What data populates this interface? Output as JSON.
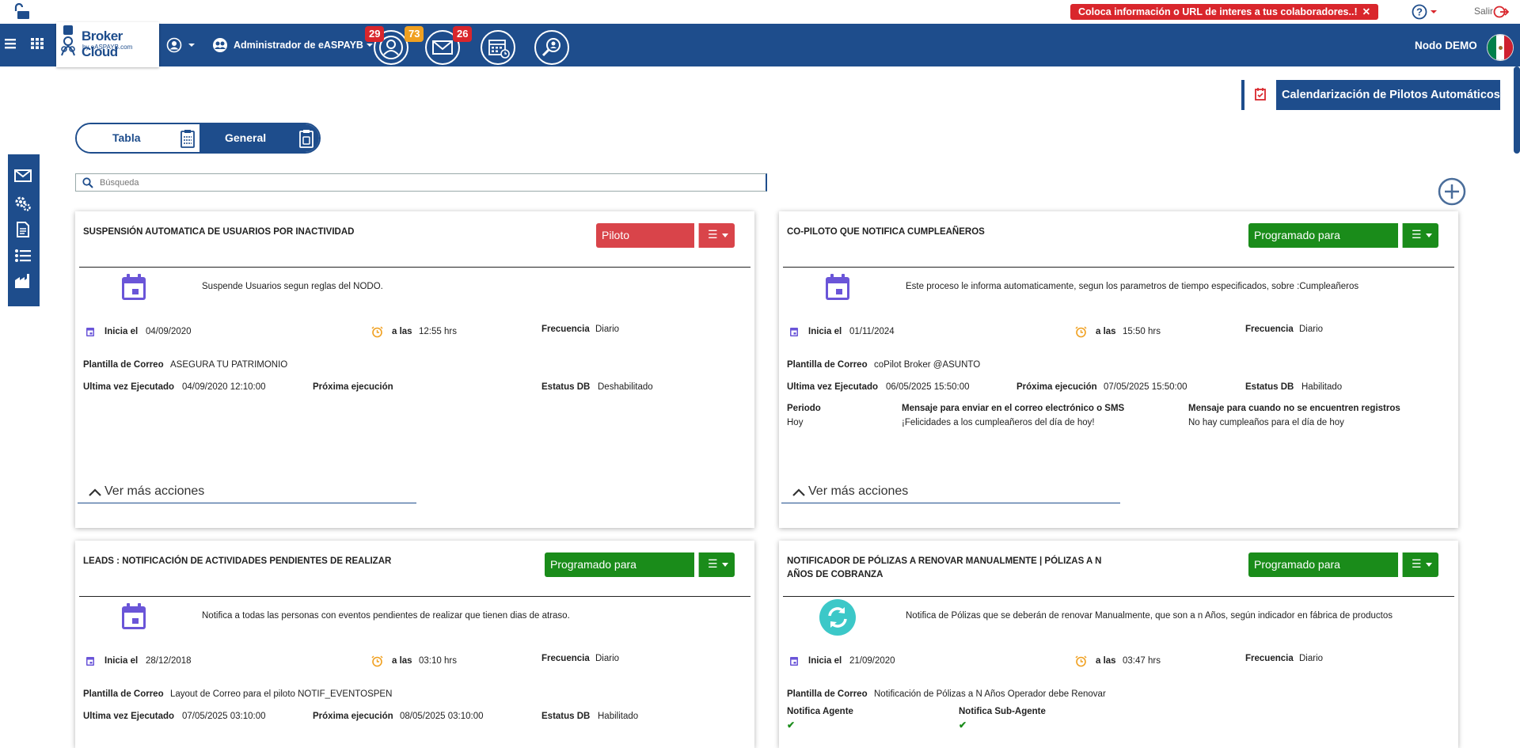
{
  "topbar": {
    "promo_text": "Coloca información o URL de interes a tus colaboradores..!",
    "promo_close": "✕",
    "logout_label": "Salir"
  },
  "nav": {
    "logo_title": "Broker Cloud",
    "logo_subtitle": "by eASPAYB.com",
    "admin_label": "Administrador de eASPAYB",
    "badge_users": "29",
    "badge_tasks": "73",
    "badge_mail": "26",
    "node_label": "Nodo DEMO"
  },
  "toolbar": {
    "calendar_button": "Calendarización de Pilotos Automáticos",
    "tab_table": "Tabla",
    "tab_general": "General",
    "search_placeholder": "Búsqueda"
  },
  "labels": {
    "inicia": "Inicia el",
    "a_las": "a las",
    "frecuencia": "Frecuencia",
    "plantilla": "Plantilla de Correo",
    "ultima": "Ultima vez Ejecutado",
    "proxima": "Próxima ejecución",
    "estatus": "Estatus DB",
    "periodo": "Periodo",
    "mensaje": "Mensaje para enviar en el correo electrónico o SMS",
    "mensaje_sin": "Mensaje para cuando no se encuentren registros",
    "notifica_agente": "Notifica Agente",
    "notifica_sub": "Notifica Sub-Agente",
    "ver_mas": "Ver más acciones",
    "menu_icon": "☰"
  },
  "cards": [
    {
      "title": "SUSPENSIÓN AUTOMATICA DE USUARIOS POR INACTIVIDAD",
      "status": "Piloto Suspendido",
      "status_color": "#d9444a",
      "icon": "calendar-icon",
      "description": "Suspende Usuarios segun reglas del NODO.",
      "inicia": "04/09/2020",
      "hora": "12:55 hrs",
      "frecuencia": "Diario",
      "plantilla": "ASEGURA TU PATRIMONIO",
      "ultima": "04/09/2020 12:10:00",
      "proxima": "",
      "estatus": "Deshabilitado"
    },
    {
      "title": "CO-PILOTO QUE NOTIFICA CUMPLEAÑEROS",
      "status": "Programado para Ejecutarse",
      "status_color": "#1a8c1a",
      "icon": "calendar-icon",
      "description": "Este proceso le informa automaticamente, segun los parametros de tiempo especificados, sobre :Cumpleañeros",
      "inicia": "01/11/2024",
      "hora": "15:50 hrs",
      "frecuencia": "Diario",
      "plantilla": "coPilot Broker @ASUNTO",
      "ultima": "06/05/2025 15:50:00",
      "proxima": "07/05/2025 15:50:00",
      "estatus": "Habilitado",
      "periodo": "Hoy",
      "mensaje": "¡Felicidades a los cumpleañeros del día de hoy!",
      "mensaje_sin": "No hay cumpleaños para el día de hoy"
    },
    {
      "title": "LEADS : NOTIFICACIÓN DE ACTIVIDADES PENDIENTES DE REALIZAR",
      "status": "Programado para Ejecutarse",
      "status_color": "#1a8c1a",
      "icon": "calendar-icon",
      "description": "Notifica a todas las personas con eventos pendientes de realizar que tienen dias de atraso.",
      "inicia": "28/12/2018",
      "hora": "03:10 hrs",
      "frecuencia": "Diario",
      "plantilla": "Layout de Correo para el piloto NOTIF_EVENTOSPEN",
      "ultima": "07/05/2025 03:10:00",
      "proxima": "08/05/2025 03:10:00",
      "estatus": "Habilitado"
    },
    {
      "title": "NOTIFICADOR DE PÓLIZAS A RENOVAR MANUALMENTE | PÓLIZAS A N AÑOS DE COBRANZA",
      "status": "Programado para Ejecutarse",
      "status_color": "#1a8c1a",
      "icon": "refresh-icon",
      "description": "Notifica de Pólizas que se deberán de renovar Manualmente, que son a n Años, según indicador en fábrica de productos",
      "inicia": "21/09/2020",
      "hora": "03:47 hrs",
      "frecuencia": "Diario",
      "plantilla": "Notificación de Pólizas a N Años Operador debe Renovar",
      "check": "✔"
    }
  ]
}
